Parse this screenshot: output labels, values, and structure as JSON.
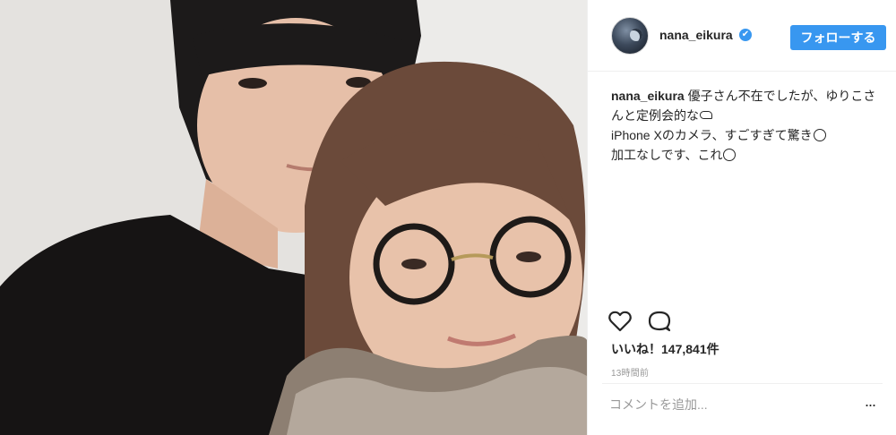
{
  "post": {
    "photo_alt": "Two women selfie"
  },
  "header": {
    "username": "nana_eikura",
    "verified_mark": "✔",
    "follow_label": "フォローする"
  },
  "caption": {
    "username": "nana_eikura",
    "line1_text": " 優子さん不在でしたが、ゆりこさんと定例会的な",
    "line2_text": "iPhone Xのカメラ、すごすぎて驚き",
    "line3_text": "加工なしです、これ"
  },
  "actions": {
    "likes_text": "いいね！147,841件",
    "timestamp": "13時間前"
  },
  "comment": {
    "placeholder": "コメントを追加...",
    "more_label": "..."
  },
  "icons": {
    "like": "heart-icon",
    "comment": "comment-icon",
    "more": "more-icon"
  },
  "colors": {
    "accent": "#3897f0",
    "text": "#262626",
    "muted": "#999999",
    "border": "#efefef"
  }
}
